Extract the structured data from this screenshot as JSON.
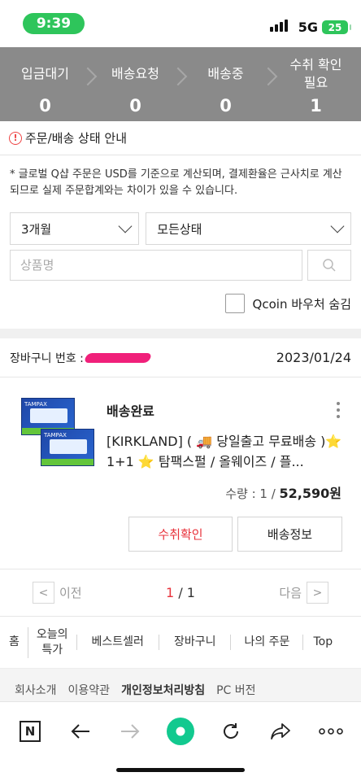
{
  "status_bar": {
    "time": "9:39",
    "network": "5G",
    "battery": "25"
  },
  "steps": [
    {
      "label": "입금대기",
      "count": "0"
    },
    {
      "label": "배송요청",
      "count": "0"
    },
    {
      "label": "배송중",
      "count": "0"
    },
    {
      "label": "수취 확인\n필요",
      "count": "1"
    }
  ],
  "info": {
    "icon": "!",
    "label": "주문/배송 상태 안내"
  },
  "notice": "* 글로벌 Q샵 주문은 USD를 기준으로 계산되며, 결제환율은 근사치로 계산되므로 실제 주문합계와는 차이가 있을 수 있습니다.",
  "filters": {
    "period": "3개월",
    "status": "모든상태",
    "search_placeholder": "상품명",
    "voucher_label": "Qcoin 바우처 숨김"
  },
  "cart": {
    "number_label": "장바구니 번호 :",
    "date": "2023/01/24",
    "item": {
      "status": "배송완료",
      "name": "[KIRKLAND] ( 🚚 당일출고 무료배송 )⭐ 1+1 ⭐ 탐팩스펄 / 올웨이즈 / 플...",
      "qty_label": "수량 : 1 / ",
      "price": "52,590원",
      "confirm_label": "수취확인",
      "shipping_label": "배송정보",
      "thumb_brand": "TAMPAX"
    }
  },
  "pager": {
    "prev": "이전",
    "current": "1",
    "total": "/ 1",
    "next": "다음"
  },
  "footer_nav": [
    "홈",
    "오늘의\n특가",
    "베스트셀러",
    "장바구니",
    "나의 주문",
    "Top"
  ],
  "sub_footer": [
    "회사소개",
    "이용약관",
    "개인정보처리방침",
    "PC 버전"
  ],
  "toolbar": {
    "n_label": "N"
  },
  "colors": {
    "status_green": "#2ec55b",
    "step_bg": "#8a8a8a",
    "accent_red": "#e8333c",
    "toolbar_green": "#12c98f"
  }
}
